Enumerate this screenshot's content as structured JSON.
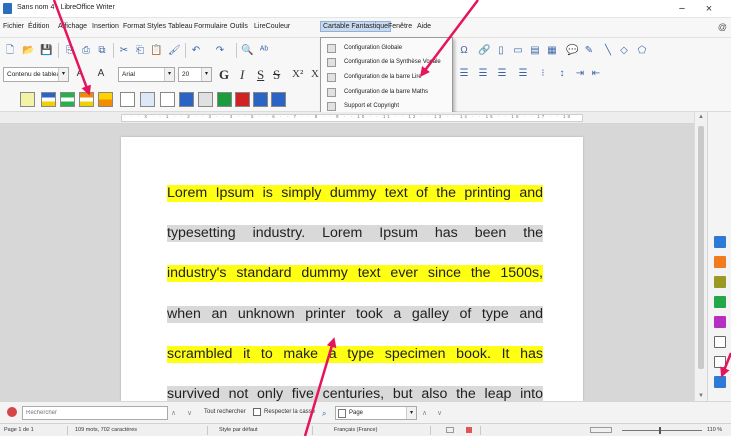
{
  "window": {
    "title": "Sans nom 4 - LibreOffice Writer",
    "minimize": "−",
    "close": "×"
  },
  "menubar": {
    "items": [
      "Fichier",
      "Édition",
      "Affichage",
      "Insertion",
      "Format",
      "Styles",
      "Tableau",
      "Formulaire",
      "Outils",
      "LireCouleur",
      "Cartable Fantastique",
      "Fenêtre",
      "Aide"
    ],
    "active_item": "Cartable Fantastique"
  },
  "cartable_menu": {
    "items": [
      "Configuration Globale",
      "Configuration de la Synthèse Vocale",
      "Configuration de la barre Lire",
      "Configuration de la barre Maths",
      "Support et Copyright"
    ]
  },
  "formatting": {
    "paragraph_style": "Contenu de tableau",
    "font_name": "Arial",
    "font_size": "20",
    "bold": "G",
    "italic": "I",
    "underline": "S",
    "strike": "S",
    "superscript": "X²",
    "subscript": "X"
  },
  "document": {
    "lines": [
      "Lorem Ipsum is simply dummy text of the printing and",
      "typesetting  industry.  Lorem  Ipsum  has  been  the",
      "industry's standard dummy text ever since the 1500s,",
      "when an unknown printer took a galley of type and",
      "scrambled it to make a type specimen book. It has",
      "survived not only five centuries, but also the leap into"
    ],
    "line_highlights": [
      "yellow",
      "gray",
      "yellow",
      "gray",
      "yellow",
      "gray"
    ]
  },
  "findbar": {
    "search_placeholder": "Rechercher",
    "find_all": "Tout rechercher",
    "match_case": "Respecter la casse",
    "search_in": "Page"
  },
  "statusbar": {
    "page": "Page 1 de 1",
    "word_count": "109 mots, 702 caractères",
    "page_style": "Style par défaut",
    "language": "Français (France)",
    "zoom": "110 %"
  },
  "colors": {
    "highlight_yellow": "#ffff14",
    "highlight_gray": "#d9d9d9",
    "annotation_arrow": "#e6145a",
    "menu_active": "#c9d9ee"
  }
}
